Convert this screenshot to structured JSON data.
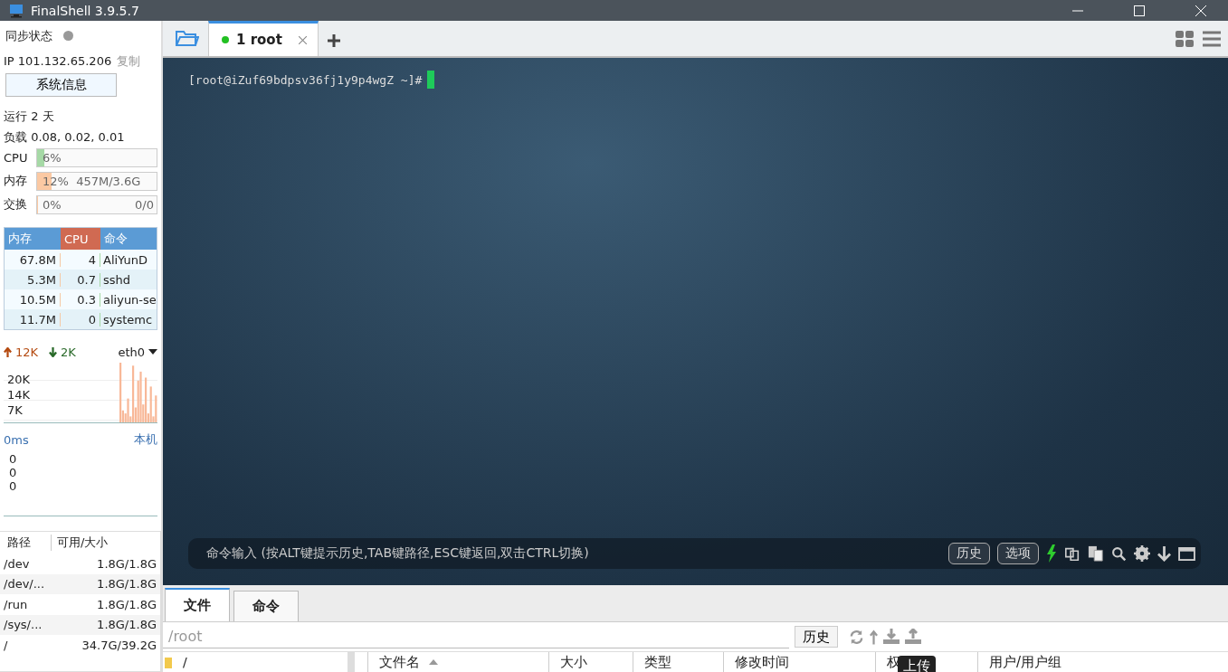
{
  "window": {
    "title": "FinalShell 3.9.5.7"
  },
  "sidebar": {
    "sync_label": "同步状态",
    "ip": "IP 101.132.65.206",
    "copy": "复制",
    "sysinfo_button": "系统信息",
    "uptime": "运行 2 天",
    "load": "负载 0.08, 0.02, 0.01",
    "meters": [
      {
        "label": "CPU",
        "level": 0.06,
        "text": "6%",
        "color": "#a6d9a6"
      },
      {
        "label": "内存",
        "level": 0.12,
        "text": "12%  457M/3.6G",
        "color": "#fbc9a3"
      },
      {
        "label": "交换",
        "level": 0,
        "text": "0%",
        "right": "0/0",
        "color": "#fbc9a3"
      }
    ],
    "processes": {
      "columns": [
        {
          "label": "内存",
          "color": "#5b9bd5"
        },
        {
          "label": "CPU",
          "color": "#d06a52"
        },
        {
          "label": "命令",
          "color": "#5b9bd5"
        }
      ],
      "rows": [
        [
          "67.8M",
          "4",
          "AliYunD"
        ],
        [
          "5.3M",
          "0.7",
          "sshd"
        ],
        [
          "10.5M",
          "0.3",
          "aliyun-se"
        ],
        [
          "11.7M",
          "0",
          "systemc"
        ]
      ]
    },
    "network": {
      "up": "12K",
      "down": "2K",
      "interface": "eth0",
      "yticks": [
        "20K",
        "14K",
        "7K"
      ]
    },
    "ping": {
      "latency": "0ms",
      "host": "本机",
      "values": [
        "0",
        "0",
        "0"
      ]
    },
    "disks": {
      "columns": [
        "路径",
        "可用/大小"
      ],
      "rows": [
        [
          "/dev",
          "1.8G/1.8G"
        ],
        [
          "/dev/...",
          "1.8G/1.8G"
        ],
        [
          "/run",
          "1.8G/1.8G"
        ],
        [
          "/sys/...",
          "1.8G/1.8G"
        ],
        [
          "/",
          "34.7G/39.2G"
        ]
      ]
    }
  },
  "tabs": [
    {
      "label": "1 root",
      "selected": true,
      "connected": true
    }
  ],
  "terminal": {
    "prompt": "[root@iZuf69bdpsv36fj1y9p4wgZ ~]#"
  },
  "command_bar": {
    "placeholder": "命令输入 (按ALT键提示历史,TAB键路径,ESC键返回,双击CTRL切换)",
    "buttons": [
      "历史",
      "选项"
    ]
  },
  "bottom_tabs": [
    {
      "label": "文件",
      "selected": true
    },
    {
      "label": "命令",
      "selected": false
    }
  ],
  "files": {
    "path": "/root",
    "history_button": "历史",
    "tree_root": "/",
    "columns": [
      "文件名",
      "大小",
      "类型",
      "修改时间",
      "权",
      "用户/用户组"
    ],
    "tooltip": "上传"
  }
}
